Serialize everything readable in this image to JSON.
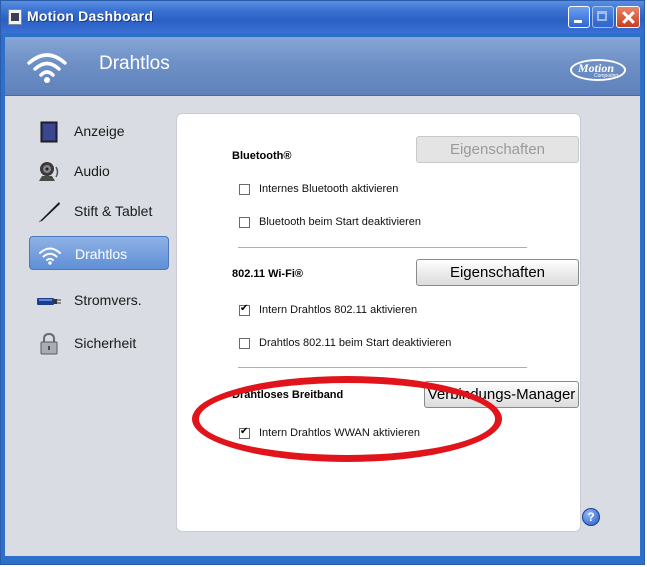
{
  "window": {
    "title": "Motion Dashboard",
    "icons": {
      "app": "app-window-icon",
      "minimize": "minimize-icon",
      "maximize": "maximize-icon",
      "close": "close-icon"
    }
  },
  "header": {
    "title": "Drahtlos",
    "icon": "wifi-icon",
    "logo": {
      "text": "Motion",
      "sub": "Computing"
    }
  },
  "sidebar": {
    "items": [
      {
        "label": "Anzeige",
        "icon": "display-icon"
      },
      {
        "label": "Audio",
        "icon": "speaker-icon"
      },
      {
        "label": "Stift & Tablet",
        "icon": "pen-icon"
      },
      {
        "label": "Drahtlos",
        "icon": "wifi-icon",
        "active": true
      },
      {
        "label": "Stromvers.",
        "icon": "battery-icon"
      },
      {
        "label": "Sicherheit",
        "icon": "lock-icon"
      }
    ]
  },
  "bluetooth": {
    "title": "Bluetooth®",
    "button": "Eigenschaften",
    "button_disabled": true,
    "options": [
      {
        "label": "Internes Bluetooth aktivieren",
        "checked": false
      },
      {
        "label": "Bluetooth beim Start deaktivieren",
        "checked": false
      }
    ]
  },
  "wifi": {
    "title": "802.11 Wi-Fi®",
    "button": "Eigenschaften",
    "options": [
      {
        "label": "Intern Drahtlos 802.11 aktivieren",
        "checked": true
      },
      {
        "label": "Drahtlos 802.11 beim Start deaktivieren",
        "checked": false
      }
    ]
  },
  "broadband": {
    "title": "Drahtloses Breitband",
    "button": "Verbindungs-Manager",
    "options": [
      {
        "label": "Intern Drahtlos WWAN aktivieren",
        "checked": true
      }
    ]
  },
  "help": {
    "icon": "help-icon",
    "glyph": "?"
  },
  "colors": {
    "highlight": "#e0141a",
    "accent": "#2c70c9"
  }
}
